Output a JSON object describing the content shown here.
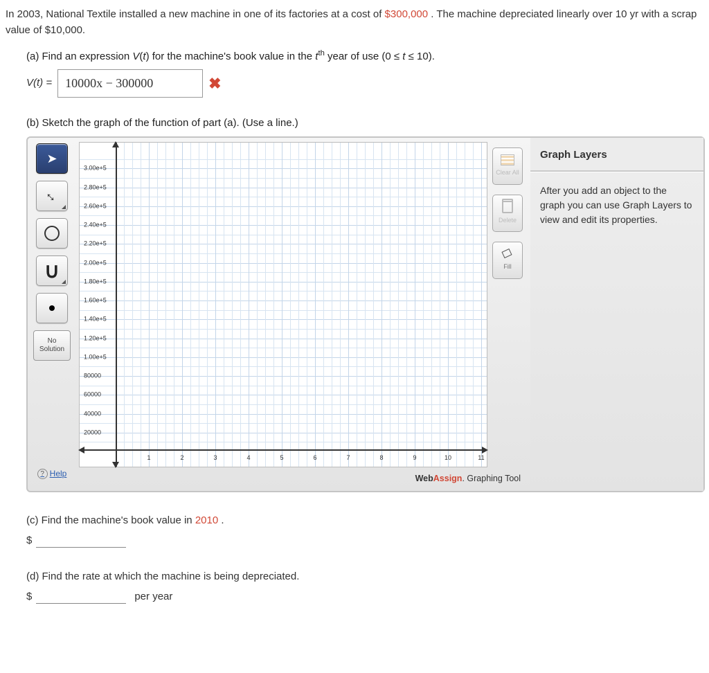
{
  "intro": {
    "pre_text": "In 2003, National Textile installed a new machine in one of its factories at a cost of ",
    "cost": "$300,000",
    "post_text": ". The machine depreciated linearly over 10 yr with a scrap value of $10,000."
  },
  "parts": {
    "a": {
      "label": "(a) Find an expression V(t) for the machine's book value in the tᵗʰ year of use (0 ≤ t ≤ 10).",
      "lhs": "V(t) = ",
      "answer": "10000x − 300000",
      "correct": false
    },
    "b": {
      "label": "(b) Sketch the graph of the function of part (a). (Use a line.)"
    },
    "c": {
      "line1": "(c) Find the machine's book value in ",
      "year": "2010",
      "after": ".",
      "currency": "$",
      "value": ""
    },
    "d": {
      "line1": "(d) Find the rate at which the machine is being depreciated.",
      "currency": "$",
      "value": "",
      "unit": "per year"
    }
  },
  "graph": {
    "tools": {
      "pointer": "pointer",
      "line": "line",
      "circle": "circle",
      "curve": "curve",
      "point": "point",
      "no_solution_l1": "No",
      "no_solution_l2": "Solution",
      "help": "Help"
    },
    "actions": {
      "clear_all": "Clear All",
      "delete": "Delete",
      "fill": "Fill"
    },
    "layers": {
      "title": "Graph Layers",
      "body": "After you add an object to the graph you can use Graph Layers to view and edit its properties."
    },
    "branding_prefix": "Web",
    "branding_accent": "Assign",
    "branding_suffix": ". Graphing Tool",
    "chart_data": {
      "type": "line",
      "title": "",
      "xlabel": "",
      "ylabel": "",
      "xlim": [
        0,
        11
      ],
      "ylim": [
        0,
        320000
      ],
      "x_ticks": [
        1,
        2,
        3,
        4,
        5,
        6,
        7,
        8,
        9,
        10,
        11
      ],
      "y_ticks": [
        20000,
        40000,
        60000,
        80000,
        100000,
        120000,
        140000,
        160000,
        180000,
        200000,
        220000,
        240000,
        260000,
        280000,
        300000
      ],
      "y_tick_labels": [
        "20000",
        "40000",
        "60000",
        "80000",
        "1.00e+5",
        "1.20e+5",
        "1.40e+5",
        "1.60e+5",
        "1.80e+5",
        "2.00e+5",
        "2.20e+5",
        "2.40e+5",
        "2.60e+5",
        "2.80e+5",
        "3.00e+5"
      ],
      "series": []
    }
  }
}
